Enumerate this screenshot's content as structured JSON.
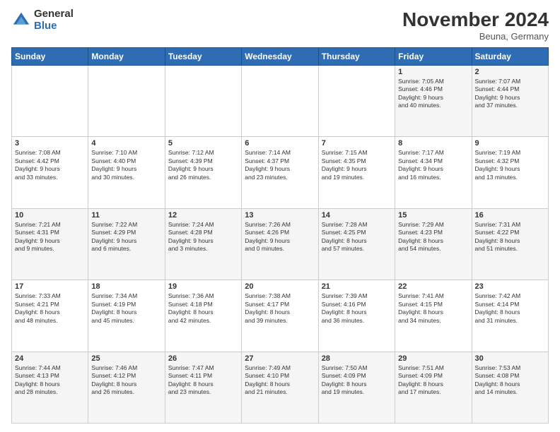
{
  "logo": {
    "general": "General",
    "blue": "Blue"
  },
  "title": "November 2024",
  "location": "Beuna, Germany",
  "headers": [
    "Sunday",
    "Monday",
    "Tuesday",
    "Wednesday",
    "Thursday",
    "Friday",
    "Saturday"
  ],
  "weeks": [
    [
      {
        "day": "",
        "info": ""
      },
      {
        "day": "",
        "info": ""
      },
      {
        "day": "",
        "info": ""
      },
      {
        "day": "",
        "info": ""
      },
      {
        "day": "",
        "info": ""
      },
      {
        "day": "1",
        "info": "Sunrise: 7:05 AM\nSunset: 4:46 PM\nDaylight: 9 hours\nand 40 minutes."
      },
      {
        "day": "2",
        "info": "Sunrise: 7:07 AM\nSunset: 4:44 PM\nDaylight: 9 hours\nand 37 minutes."
      }
    ],
    [
      {
        "day": "3",
        "info": "Sunrise: 7:08 AM\nSunset: 4:42 PM\nDaylight: 9 hours\nand 33 minutes."
      },
      {
        "day": "4",
        "info": "Sunrise: 7:10 AM\nSunset: 4:40 PM\nDaylight: 9 hours\nand 30 minutes."
      },
      {
        "day": "5",
        "info": "Sunrise: 7:12 AM\nSunset: 4:39 PM\nDaylight: 9 hours\nand 26 minutes."
      },
      {
        "day": "6",
        "info": "Sunrise: 7:14 AM\nSunset: 4:37 PM\nDaylight: 9 hours\nand 23 minutes."
      },
      {
        "day": "7",
        "info": "Sunrise: 7:15 AM\nSunset: 4:35 PM\nDaylight: 9 hours\nand 19 minutes."
      },
      {
        "day": "8",
        "info": "Sunrise: 7:17 AM\nSunset: 4:34 PM\nDaylight: 9 hours\nand 16 minutes."
      },
      {
        "day": "9",
        "info": "Sunrise: 7:19 AM\nSunset: 4:32 PM\nDaylight: 9 hours\nand 13 minutes."
      }
    ],
    [
      {
        "day": "10",
        "info": "Sunrise: 7:21 AM\nSunset: 4:31 PM\nDaylight: 9 hours\nand 9 minutes."
      },
      {
        "day": "11",
        "info": "Sunrise: 7:22 AM\nSunset: 4:29 PM\nDaylight: 9 hours\nand 6 minutes."
      },
      {
        "day": "12",
        "info": "Sunrise: 7:24 AM\nSunset: 4:28 PM\nDaylight: 9 hours\nand 3 minutes."
      },
      {
        "day": "13",
        "info": "Sunrise: 7:26 AM\nSunset: 4:26 PM\nDaylight: 9 hours\nand 0 minutes."
      },
      {
        "day": "14",
        "info": "Sunrise: 7:28 AM\nSunset: 4:25 PM\nDaylight: 8 hours\nand 57 minutes."
      },
      {
        "day": "15",
        "info": "Sunrise: 7:29 AM\nSunset: 4:23 PM\nDaylight: 8 hours\nand 54 minutes."
      },
      {
        "day": "16",
        "info": "Sunrise: 7:31 AM\nSunset: 4:22 PM\nDaylight: 8 hours\nand 51 minutes."
      }
    ],
    [
      {
        "day": "17",
        "info": "Sunrise: 7:33 AM\nSunset: 4:21 PM\nDaylight: 8 hours\nand 48 minutes."
      },
      {
        "day": "18",
        "info": "Sunrise: 7:34 AM\nSunset: 4:19 PM\nDaylight: 8 hours\nand 45 minutes."
      },
      {
        "day": "19",
        "info": "Sunrise: 7:36 AM\nSunset: 4:18 PM\nDaylight: 8 hours\nand 42 minutes."
      },
      {
        "day": "20",
        "info": "Sunrise: 7:38 AM\nSunset: 4:17 PM\nDaylight: 8 hours\nand 39 minutes."
      },
      {
        "day": "21",
        "info": "Sunrise: 7:39 AM\nSunset: 4:16 PM\nDaylight: 8 hours\nand 36 minutes."
      },
      {
        "day": "22",
        "info": "Sunrise: 7:41 AM\nSunset: 4:15 PM\nDaylight: 8 hours\nand 34 minutes."
      },
      {
        "day": "23",
        "info": "Sunrise: 7:42 AM\nSunset: 4:14 PM\nDaylight: 8 hours\nand 31 minutes."
      }
    ],
    [
      {
        "day": "24",
        "info": "Sunrise: 7:44 AM\nSunset: 4:13 PM\nDaylight: 8 hours\nand 28 minutes."
      },
      {
        "day": "25",
        "info": "Sunrise: 7:46 AM\nSunset: 4:12 PM\nDaylight: 8 hours\nand 26 minutes."
      },
      {
        "day": "26",
        "info": "Sunrise: 7:47 AM\nSunset: 4:11 PM\nDaylight: 8 hours\nand 23 minutes."
      },
      {
        "day": "27",
        "info": "Sunrise: 7:49 AM\nSunset: 4:10 PM\nDaylight: 8 hours\nand 21 minutes."
      },
      {
        "day": "28",
        "info": "Sunrise: 7:50 AM\nSunset: 4:09 PM\nDaylight: 8 hours\nand 19 minutes."
      },
      {
        "day": "29",
        "info": "Sunrise: 7:51 AM\nSunset: 4:09 PM\nDaylight: 8 hours\nand 17 minutes."
      },
      {
        "day": "30",
        "info": "Sunrise: 7:53 AM\nSunset: 4:08 PM\nDaylight: 8 hours\nand 14 minutes."
      }
    ]
  ]
}
